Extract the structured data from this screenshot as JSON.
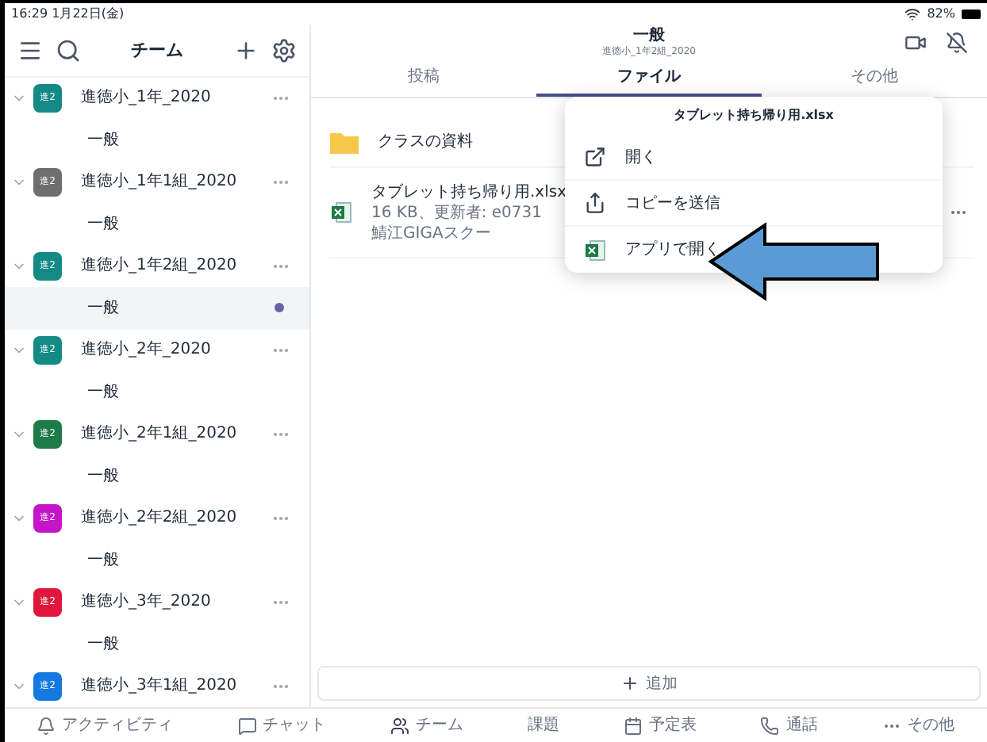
{
  "status_bar": {
    "time": "16:29 1月22日(金)",
    "battery": "82%"
  },
  "sidebar": {
    "title": "チーム",
    "teams": [
      {
        "name": "進徳小_1年_2020",
        "avatar": "進2",
        "color": "#138a86",
        "channels": [
          {
            "name": "一般",
            "selected": false,
            "unread": false
          }
        ]
      },
      {
        "name": "進徳小_1年1組_2020",
        "avatar": "進2",
        "color": "#6e6e6e",
        "channels": [
          {
            "name": "一般",
            "selected": false,
            "unread": false
          }
        ]
      },
      {
        "name": "進徳小_1年2組_2020",
        "avatar": "進2",
        "color": "#138a86",
        "channels": [
          {
            "name": "一般",
            "selected": true,
            "unread": true
          }
        ]
      },
      {
        "name": "進徳小_2年_2020",
        "avatar": "進2",
        "color": "#138a86",
        "channels": [
          {
            "name": "一般",
            "selected": false,
            "unread": false
          }
        ]
      },
      {
        "name": "進徳小_2年1組_2020",
        "avatar": "進2",
        "color": "#1f7a4a",
        "channels": [
          {
            "name": "一般",
            "selected": false,
            "unread": false
          }
        ]
      },
      {
        "name": "進徳小_2年2組_2020",
        "avatar": "進2",
        "color": "#c416c8",
        "channels": [
          {
            "name": "一般",
            "selected": false,
            "unread": false
          }
        ]
      },
      {
        "name": "進徳小_3年_2020",
        "avatar": "進2",
        "color": "#e0173d",
        "channels": [
          {
            "name": "一般",
            "selected": false,
            "unread": false
          }
        ]
      },
      {
        "name": "進徳小_3年1組_2020",
        "avatar": "進2",
        "color": "#1479e0"
      }
    ]
  },
  "header": {
    "title": "一般",
    "subtitle": "進徳小_1年2組_2020"
  },
  "tabs": [
    {
      "label": "投稿",
      "selected": false
    },
    {
      "label": "ファイル",
      "selected": true
    },
    {
      "label": "その他",
      "selected": false
    }
  ],
  "files": [
    {
      "kind": "folder",
      "name": "クラスの資料"
    },
    {
      "kind": "excel",
      "name": "タブレット持ち帰り用.xlsx",
      "detail": "16 KB、更新者: e0731 鯖江GIGAスクー"
    }
  ],
  "menu": {
    "title": "タブレット持ち帰り用.xlsx",
    "items": [
      {
        "kind": "open",
        "label": "開く"
      },
      {
        "kind": "share",
        "label": "コピーを送信"
      },
      {
        "kind": "app",
        "label": "アプリで開く"
      }
    ]
  },
  "add_button": "追加",
  "nav": [
    {
      "kind": "bell",
      "label": "アクティビティ"
    },
    {
      "kind": "chat",
      "label": "チャット"
    },
    {
      "kind": "teams",
      "label": "チーム"
    },
    {
      "kind": "none",
      "label": "課題"
    },
    {
      "kind": "calendar",
      "label": "予定表"
    },
    {
      "kind": "phone",
      "label": "通話"
    },
    {
      "kind": "more",
      "label": "その他"
    }
  ]
}
